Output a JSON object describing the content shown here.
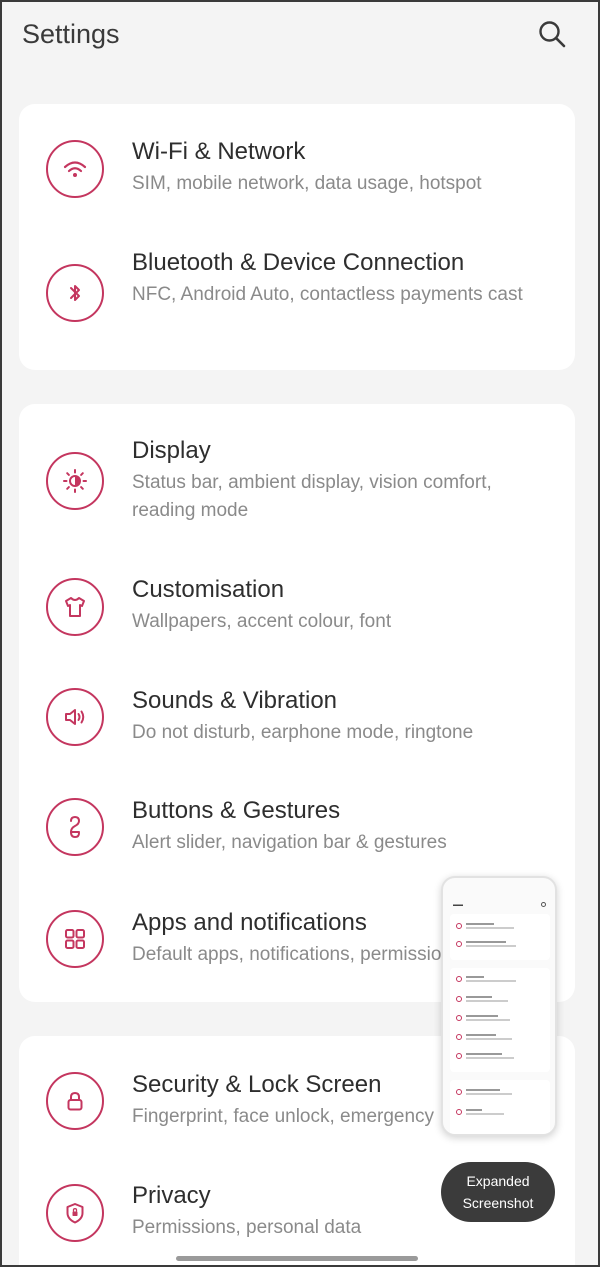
{
  "header": {
    "title": "Settings",
    "search_icon": "search-icon"
  },
  "accent_color": "#c4365f",
  "groups": [
    {
      "items": [
        {
          "title": "Wi-Fi & Network",
          "subtitle": "SIM, mobile network, data usage, hotspot",
          "icon": "wifi-icon"
        },
        {
          "title": "Bluetooth & Device Connection",
          "subtitle": "NFC, Android Auto, contactless payments cast",
          "icon": "bluetooth-icon"
        }
      ]
    },
    {
      "items": [
        {
          "title": "Display",
          "subtitle": "Status bar, ambient display, vision comfort, reading mode",
          "icon": "brightness-icon"
        },
        {
          "title": "Customisation",
          "subtitle": "Wallpapers, accent colour, font",
          "icon": "tshirt-icon"
        },
        {
          "title": "Sounds & Vibration",
          "subtitle": "Do not disturb, earphone mode, ringtone",
          "icon": "speaker-icon"
        },
        {
          "title": "Buttons & Gestures",
          "subtitle": "Alert slider, navigation bar & gestures",
          "icon": "gesture-icon"
        },
        {
          "title": "Apps and notifications",
          "subtitle": "Default apps, notifications, permissions",
          "icon": "apps-grid-icon"
        }
      ]
    },
    {
      "items": [
        {
          "title": "Security & Lock Screen",
          "subtitle": "Fingerprint, face unlock, emergency",
          "icon": "lock-icon"
        },
        {
          "title": "Privacy",
          "subtitle": "Permissions, personal data",
          "icon": "shield-icon"
        }
      ]
    }
  ],
  "screenshot_toast": {
    "line1": "Expanded",
    "line2": "Screenshot"
  }
}
